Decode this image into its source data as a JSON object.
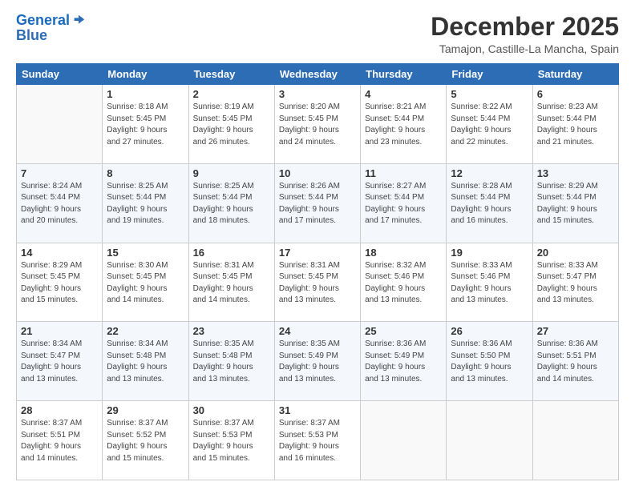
{
  "header": {
    "logo_line1": "General",
    "logo_line2": "Blue",
    "title": "December 2025",
    "subtitle": "Tamajon, Castille-La Mancha, Spain"
  },
  "days_of_week": [
    "Sunday",
    "Monday",
    "Tuesday",
    "Wednesday",
    "Thursday",
    "Friday",
    "Saturday"
  ],
  "weeks": [
    [
      {
        "day": "",
        "info": ""
      },
      {
        "day": "1",
        "info": "Sunrise: 8:18 AM\nSunset: 5:45 PM\nDaylight: 9 hours\nand 27 minutes."
      },
      {
        "day": "2",
        "info": "Sunrise: 8:19 AM\nSunset: 5:45 PM\nDaylight: 9 hours\nand 26 minutes."
      },
      {
        "day": "3",
        "info": "Sunrise: 8:20 AM\nSunset: 5:45 PM\nDaylight: 9 hours\nand 24 minutes."
      },
      {
        "day": "4",
        "info": "Sunrise: 8:21 AM\nSunset: 5:44 PM\nDaylight: 9 hours\nand 23 minutes."
      },
      {
        "day": "5",
        "info": "Sunrise: 8:22 AM\nSunset: 5:44 PM\nDaylight: 9 hours\nand 22 minutes."
      },
      {
        "day": "6",
        "info": "Sunrise: 8:23 AM\nSunset: 5:44 PM\nDaylight: 9 hours\nand 21 minutes."
      }
    ],
    [
      {
        "day": "7",
        "info": "Sunrise: 8:24 AM\nSunset: 5:44 PM\nDaylight: 9 hours\nand 20 minutes."
      },
      {
        "day": "8",
        "info": "Sunrise: 8:25 AM\nSunset: 5:44 PM\nDaylight: 9 hours\nand 19 minutes."
      },
      {
        "day": "9",
        "info": "Sunrise: 8:25 AM\nSunset: 5:44 PM\nDaylight: 9 hours\nand 18 minutes."
      },
      {
        "day": "10",
        "info": "Sunrise: 8:26 AM\nSunset: 5:44 PM\nDaylight: 9 hours\nand 17 minutes."
      },
      {
        "day": "11",
        "info": "Sunrise: 8:27 AM\nSunset: 5:44 PM\nDaylight: 9 hours\nand 17 minutes."
      },
      {
        "day": "12",
        "info": "Sunrise: 8:28 AM\nSunset: 5:44 PM\nDaylight: 9 hours\nand 16 minutes."
      },
      {
        "day": "13",
        "info": "Sunrise: 8:29 AM\nSunset: 5:44 PM\nDaylight: 9 hours\nand 15 minutes."
      }
    ],
    [
      {
        "day": "14",
        "info": "Sunrise: 8:29 AM\nSunset: 5:45 PM\nDaylight: 9 hours\nand 15 minutes."
      },
      {
        "day": "15",
        "info": "Sunrise: 8:30 AM\nSunset: 5:45 PM\nDaylight: 9 hours\nand 14 minutes."
      },
      {
        "day": "16",
        "info": "Sunrise: 8:31 AM\nSunset: 5:45 PM\nDaylight: 9 hours\nand 14 minutes."
      },
      {
        "day": "17",
        "info": "Sunrise: 8:31 AM\nSunset: 5:45 PM\nDaylight: 9 hours\nand 13 minutes."
      },
      {
        "day": "18",
        "info": "Sunrise: 8:32 AM\nSunset: 5:46 PM\nDaylight: 9 hours\nand 13 minutes."
      },
      {
        "day": "19",
        "info": "Sunrise: 8:33 AM\nSunset: 5:46 PM\nDaylight: 9 hours\nand 13 minutes."
      },
      {
        "day": "20",
        "info": "Sunrise: 8:33 AM\nSunset: 5:47 PM\nDaylight: 9 hours\nand 13 minutes."
      }
    ],
    [
      {
        "day": "21",
        "info": "Sunrise: 8:34 AM\nSunset: 5:47 PM\nDaylight: 9 hours\nand 13 minutes."
      },
      {
        "day": "22",
        "info": "Sunrise: 8:34 AM\nSunset: 5:48 PM\nDaylight: 9 hours\nand 13 minutes."
      },
      {
        "day": "23",
        "info": "Sunrise: 8:35 AM\nSunset: 5:48 PM\nDaylight: 9 hours\nand 13 minutes."
      },
      {
        "day": "24",
        "info": "Sunrise: 8:35 AM\nSunset: 5:49 PM\nDaylight: 9 hours\nand 13 minutes."
      },
      {
        "day": "25",
        "info": "Sunrise: 8:36 AM\nSunset: 5:49 PM\nDaylight: 9 hours\nand 13 minutes."
      },
      {
        "day": "26",
        "info": "Sunrise: 8:36 AM\nSunset: 5:50 PM\nDaylight: 9 hours\nand 13 minutes."
      },
      {
        "day": "27",
        "info": "Sunrise: 8:36 AM\nSunset: 5:51 PM\nDaylight: 9 hours\nand 14 minutes."
      }
    ],
    [
      {
        "day": "28",
        "info": "Sunrise: 8:37 AM\nSunset: 5:51 PM\nDaylight: 9 hours\nand 14 minutes."
      },
      {
        "day": "29",
        "info": "Sunrise: 8:37 AM\nSunset: 5:52 PM\nDaylight: 9 hours\nand 15 minutes."
      },
      {
        "day": "30",
        "info": "Sunrise: 8:37 AM\nSunset: 5:53 PM\nDaylight: 9 hours\nand 15 minutes."
      },
      {
        "day": "31",
        "info": "Sunrise: 8:37 AM\nSunset: 5:53 PM\nDaylight: 9 hours\nand 16 minutes."
      },
      {
        "day": "",
        "info": ""
      },
      {
        "day": "",
        "info": ""
      },
      {
        "day": "",
        "info": ""
      }
    ]
  ]
}
